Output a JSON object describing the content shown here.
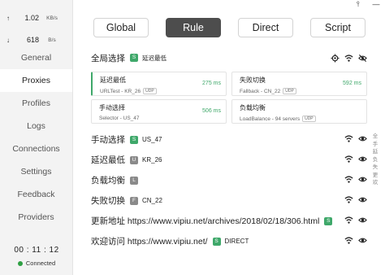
{
  "window": {
    "pin_glyph": "⫯",
    "minimize_glyph": "—"
  },
  "traffic": {
    "up": {
      "arrow": "↑",
      "value": "1.02",
      "unit": "KB/s"
    },
    "down": {
      "arrow": "↓",
      "value": "618",
      "unit": "B/s"
    }
  },
  "nav": [
    "General",
    "Proxies",
    "Profiles",
    "Logs",
    "Connections",
    "Settings",
    "Feedback",
    "Providers"
  ],
  "nav_active": "Proxies",
  "status": {
    "uptime": "00 : 11 : 12",
    "connection": "Connected"
  },
  "modes": {
    "global": "Global",
    "rule": "Rule",
    "direct": "Direct",
    "script": "Script",
    "active": "Rule"
  },
  "global_group": {
    "name": "全局选择",
    "tag": "S",
    "now": "延迟最低",
    "proxies": [
      {
        "name": "延迟最低",
        "type": "URLTest - KR_26",
        "udp": "UDP",
        "delay": "275 ms",
        "selected": true
      },
      {
        "name": "失败切换",
        "type": "Fallback - CN_22",
        "udp": "UDP",
        "delay": "592 ms",
        "selected": false
      },
      {
        "name": "手动选择",
        "type": "Selector - US_47",
        "udp": "",
        "delay": "506 ms",
        "selected": false
      },
      {
        "name": "负载均衡",
        "type": "LoadBalance - 94 servers",
        "udp": "UDP",
        "delay": "",
        "selected": false
      }
    ]
  },
  "groups": [
    {
      "name": "手动选择",
      "tag": "S",
      "now": "US_47"
    },
    {
      "name": "延迟最低",
      "tag": "U",
      "now": "KR_26"
    },
    {
      "name": "负载均衡",
      "tag": "L",
      "now": ""
    },
    {
      "name": "失败切换",
      "tag": "F",
      "now": "CN_22"
    },
    {
      "name": "更新地址 https://www.vipiu.net/archives/2018/02/18/306.html",
      "tag": "S",
      "now": ""
    },
    {
      "name": "欢迎访问 https://www.vipiu.net/",
      "tag": "S",
      "now": "DIRECT"
    }
  ],
  "side_index": [
    "全",
    "手",
    "延",
    "负",
    "失",
    "更",
    "欢"
  ],
  "colors": {
    "accent": "#3fa86a",
    "active_tab": "#4d4d4d"
  },
  "icons": {
    "locate": "target-icon",
    "speed": "wifi-icon",
    "visibility": "eye-icon",
    "hidden": "eye-off-icon"
  }
}
